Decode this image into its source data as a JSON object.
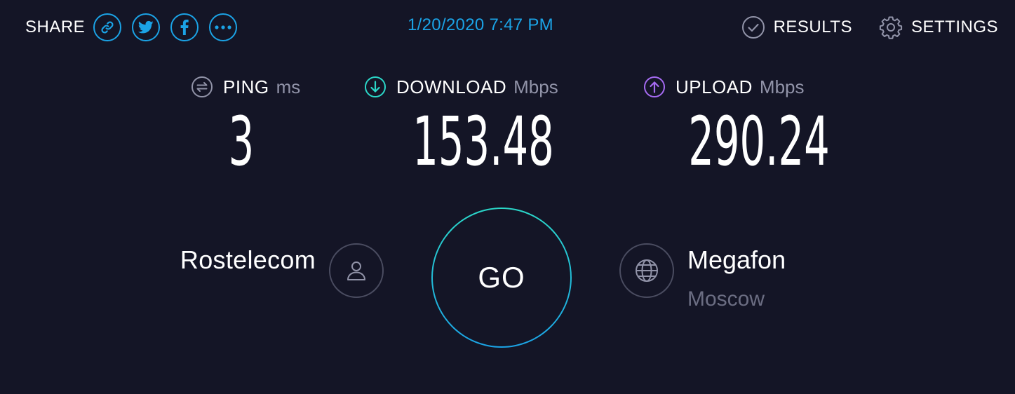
{
  "header": {
    "share_label": "SHARE",
    "share_buttons": [
      {
        "icon": "link-icon"
      },
      {
        "icon": "twitter-icon"
      },
      {
        "icon": "facebook-icon"
      },
      {
        "icon": "more-icon"
      }
    ],
    "timestamp": "1/20/2020 7:47 PM",
    "results_label": "RESULTS",
    "settings_label": "SETTINGS"
  },
  "metrics": {
    "ping": {
      "label": "PING",
      "unit": "ms",
      "value": "3",
      "icon": "ping-icon"
    },
    "download": {
      "label": "DOWNLOAD",
      "unit": "Mbps",
      "value": "153.48",
      "icon": "download-icon"
    },
    "upload": {
      "label": "UPLOAD",
      "unit": "Mbps",
      "value": "290.24",
      "icon": "upload-icon"
    }
  },
  "isp": {
    "name": "Rostelecom",
    "icon": "user-icon"
  },
  "go_button": {
    "label": "GO"
  },
  "server": {
    "name": "Megafon",
    "location": "Moscow",
    "icon": "globe-icon"
  },
  "colors": {
    "background": "#141526",
    "accent_blue": "#1ba3e6",
    "download_teal": "#2bd8c9",
    "upload_purple": "#a66bf2",
    "muted_text": "#9193a8"
  }
}
